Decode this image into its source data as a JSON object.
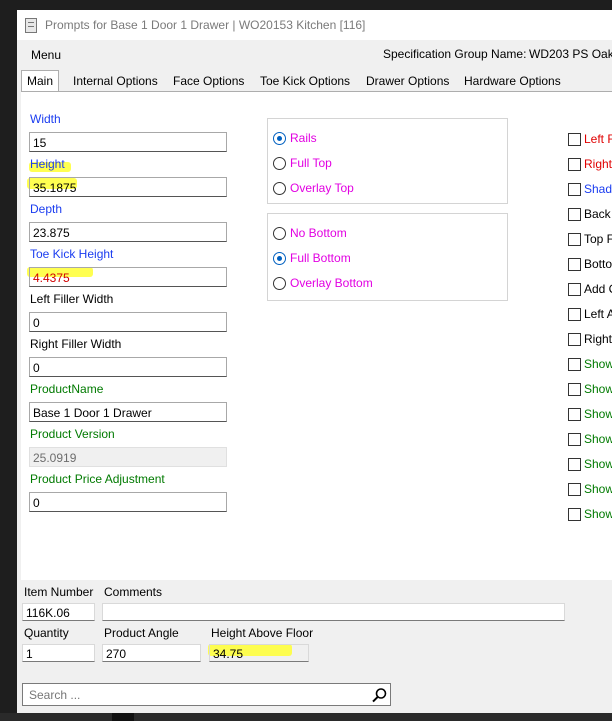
{
  "window": {
    "title": "Prompts for Base 1 Door 1 Drawer | WO20153 Kitchen [116]"
  },
  "menu": {
    "label": "Menu"
  },
  "spec_group": {
    "label": "Specification Group Name:",
    "value": "WD203 PS Oak"
  },
  "tabs": [
    {
      "label": "Main",
      "active": true
    },
    {
      "label": "Internal Options"
    },
    {
      "label": "Face Options"
    },
    {
      "label": "Toe Kick Options"
    },
    {
      "label": "Drawer Options"
    },
    {
      "label": "Hardware Options"
    }
  ],
  "fields": [
    {
      "label": "Width",
      "value": "15",
      "color": "#1a3cf0"
    },
    {
      "label": "Height",
      "value": "35.1875",
      "color": "#1a3cf0"
    },
    {
      "label": "Depth",
      "value": "23.875",
      "color": "#1a3cf0"
    },
    {
      "label": "Toe Kick Height",
      "value": "4.4375",
      "color": "#1a3cf0"
    },
    {
      "label": "Left Filler Width",
      "value": "0",
      "color": "#000000"
    },
    {
      "label": "Right Filler Width",
      "value": "0",
      "color": "#000000"
    },
    {
      "label": "ProductName",
      "value": "Base 1 Door 1 Drawer",
      "color": "#007a00"
    },
    {
      "label": "Product Version",
      "value": "25.0919",
      "color": "#007a00",
      "readonly": true
    },
    {
      "label": "Product Price Adjustment",
      "value": "0",
      "color": "#007a00"
    }
  ],
  "top_group": [
    {
      "label": "Rails",
      "selected": true
    },
    {
      "label": "Full Top",
      "selected": false
    },
    {
      "label": "Overlay Top",
      "selected": false
    }
  ],
  "bottom_group": [
    {
      "label": "No Bottom",
      "selected": false
    },
    {
      "label": "Full Bottom",
      "selected": true
    },
    {
      "label": "Overlay Bottom",
      "selected": false
    }
  ],
  "checkboxes": [
    {
      "label": "Left F",
      "color": "#e00000"
    },
    {
      "label": "Right",
      "color": "#e00000"
    },
    {
      "label": "Shado",
      "color": "#1a3cf0"
    },
    {
      "label": "Back",
      "color": "#000000"
    },
    {
      "label": "Top F",
      "color": "#000000"
    },
    {
      "label": "Botto",
      "color": "#000000"
    },
    {
      "label": "Add C",
      "color": "#000000"
    },
    {
      "label": "Left A",
      "color": "#000000"
    },
    {
      "label": "Right",
      "color": "#000000"
    },
    {
      "label": "Show",
      "color": "#007a00"
    },
    {
      "label": "Show",
      "color": "#007a00"
    },
    {
      "label": "Show",
      "color": "#007a00"
    },
    {
      "label": "Show",
      "color": "#007a00"
    },
    {
      "label": "Show",
      "color": "#007a00"
    },
    {
      "label": "Show",
      "color": "#007a00"
    },
    {
      "label": "Show",
      "color": "#007a00"
    }
  ],
  "bottom": {
    "item_number": {
      "label": "Item Number",
      "value": "116K.06"
    },
    "comments": {
      "label": "Comments",
      "value": ""
    },
    "quantity": {
      "label": "Quantity",
      "value": "1"
    },
    "product_angle": {
      "label": "Product Angle",
      "value": "270"
    },
    "height_above_floor": {
      "label": "Height Above Floor",
      "value": "34.75"
    }
  },
  "search": {
    "placeholder": "Search ..."
  },
  "highlight_color": "#ffff33"
}
